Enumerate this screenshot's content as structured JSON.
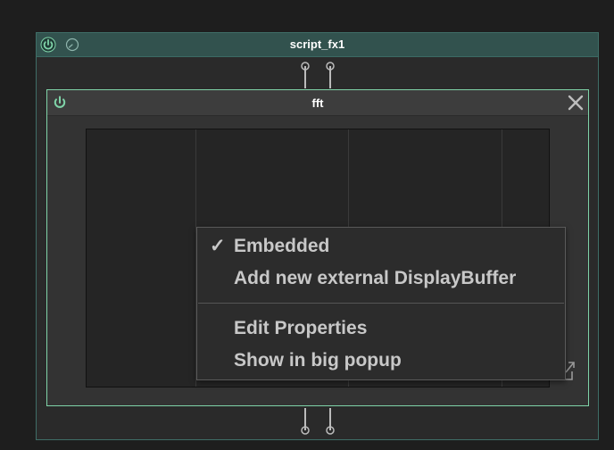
{
  "outer_module": {
    "title": "script_fx1"
  },
  "inner_module": {
    "title": "fft"
  },
  "context_menu": {
    "items": [
      {
        "label": "Embedded",
        "checked": true,
        "check_glyph": "✓"
      },
      {
        "label": "Add new external DisplayBuffer",
        "checked": false
      },
      {
        "label": "Edit Properties",
        "checked": false
      },
      {
        "label": "Show in big popup",
        "checked": false
      }
    ]
  },
  "colors": {
    "accent_green": "#7fd3a8",
    "header_teal": "#32524e",
    "background": "#1e1e1e"
  },
  "icons": {
    "outer_power": "power-icon",
    "outer_bypass": "bypass-knob-icon",
    "inner_power": "power-icon",
    "close": "close-icon",
    "popup": "popup-expand-icon"
  }
}
